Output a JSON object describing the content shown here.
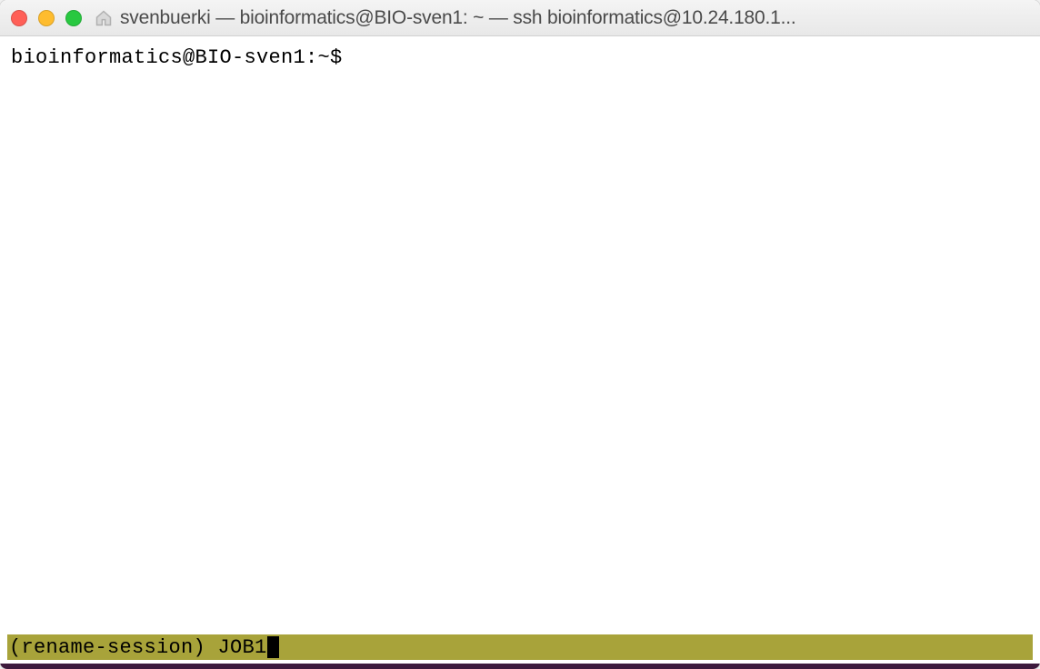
{
  "titlebar": {
    "title": "svenbuerki — bioinformatics@BIO-sven1: ~ — ssh bioinformatics@10.24.180.1..."
  },
  "terminal": {
    "prompt": "bioinformatics@BIO-sven1:~$"
  },
  "statusbar": {
    "label": "(rename-session) ",
    "input_value": "JOB1"
  },
  "colors": {
    "status_bg": "#a8a33a",
    "cursor": "#000000"
  }
}
